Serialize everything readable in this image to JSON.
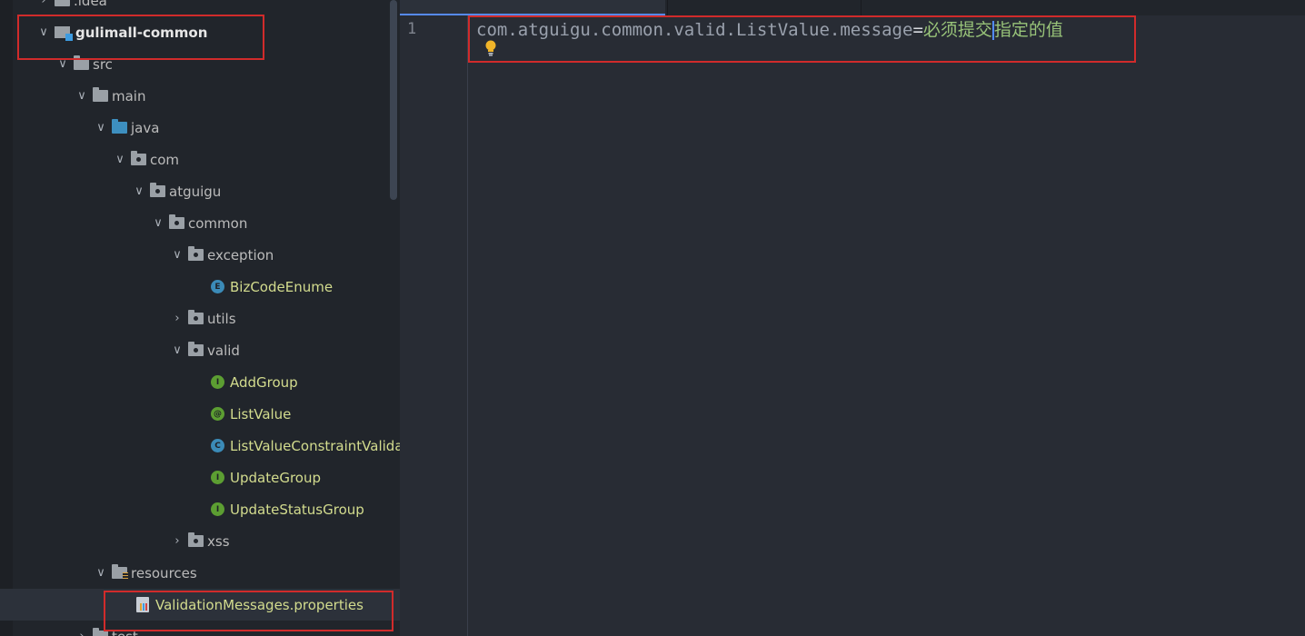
{
  "tree": {
    "items": [
      {
        "label": ".idea",
        "type": "folder"
      },
      {
        "label": "gulimall-common",
        "type": "module"
      },
      {
        "label": "src",
        "type": "folder"
      },
      {
        "label": "main",
        "type": "folder"
      },
      {
        "label": "java",
        "type": "source-folder"
      },
      {
        "label": "com",
        "type": "package"
      },
      {
        "label": "atguigu",
        "type": "package"
      },
      {
        "label": "common",
        "type": "package"
      },
      {
        "label": "exception",
        "type": "package"
      },
      {
        "label": "BizCodeEnume",
        "type": "enum",
        "badge": "E"
      },
      {
        "label": "utils",
        "type": "package"
      },
      {
        "label": "valid",
        "type": "package"
      },
      {
        "label": "AddGroup",
        "type": "interface",
        "badge": "I"
      },
      {
        "label": "ListValue",
        "type": "annotation",
        "badge": "@"
      },
      {
        "label": "ListValueConstraintValidator",
        "type": "class",
        "badge": "C"
      },
      {
        "label": "UpdateGroup",
        "type": "interface",
        "badge": "I"
      },
      {
        "label": "UpdateStatusGroup",
        "type": "interface",
        "badge": "I"
      },
      {
        "label": "xss",
        "type": "package"
      },
      {
        "label": "resources",
        "type": "resources-folder"
      },
      {
        "label": "ValidationMessages.properties",
        "type": "properties-file"
      },
      {
        "label": "test",
        "type": "folder"
      }
    ]
  },
  "editor": {
    "line_number": "1",
    "key": "com.atguigu.common.valid.ListValue.message",
    "eq": "=",
    "value_before_caret": "必须提交",
    "value_after_caret": "指定的值"
  },
  "colors": {
    "highlight": "#d12b2b",
    "accent": "#568af2"
  },
  "icons": [
    "chevron-down-icon",
    "chevron-right-icon",
    "folder-icon",
    "package-icon",
    "module-icon",
    "interface-icon",
    "enum-icon",
    "class-icon",
    "annotation-icon",
    "properties-file-icon",
    "lightbulb-icon"
  ]
}
